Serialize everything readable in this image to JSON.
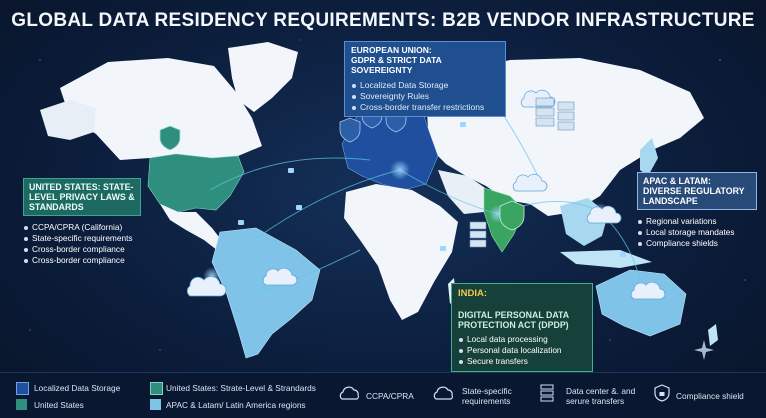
{
  "title": "GLOBAL DATA RESIDENCY REQUIREMENTS: B2B VENDOR INFRASTRUCTURE",
  "eu": {
    "heading_line1": "EUROPEAN UNION:",
    "heading_line2": "GDPR & STRICT DATA SOVEREIGNTY",
    "items": [
      "Localized Data Storage",
      "Sovereignty Rules",
      "Cross-border transfer restrictions"
    ]
  },
  "us": {
    "heading": "UNITED STATES: STATE-LEVEL PRIVACY LAWS & STANDARDS",
    "items": [
      "CCPA/CPRA (California)",
      "State-specific requirements",
      "Cross-border compliance",
      "Cross-border compliance"
    ]
  },
  "apac": {
    "heading": "APAC & LATAM: DIVERSE REGULATORY LANDSCAPE",
    "items": [
      "Regional variations",
      "Local storage mandates",
      "Compliance shields"
    ]
  },
  "india": {
    "heading": "INDIA:",
    "subheading": "DIGITAL PERSONAL DATA PROTECTION ACT (DPDP)",
    "items": [
      "Local data processing",
      "Personal data localization",
      "Secure transfers"
    ]
  },
  "legend": {
    "localized": "Localized Data Storage",
    "us_state": "United States: Strate-Level & Strandards",
    "us": "United States",
    "apac": "APAC & Latam/ Latin America regions",
    "ccpa": "CCPA/CPRA",
    "state_req": "State-specific requirements",
    "datacenter": "Data center &. and serure transfers",
    "shield": "Compliance shield"
  },
  "colors": {
    "background": "#0b1a33",
    "eu_blue": "#1f4f9e",
    "us_teal": "#2f8f7f",
    "apac_light": "#7fc4e8",
    "india_green": "#3aa563",
    "land": "#ffffff"
  },
  "icons": [
    "cloud-lock-icon",
    "shield-lock-icon",
    "server-icon",
    "lock-icon"
  ]
}
